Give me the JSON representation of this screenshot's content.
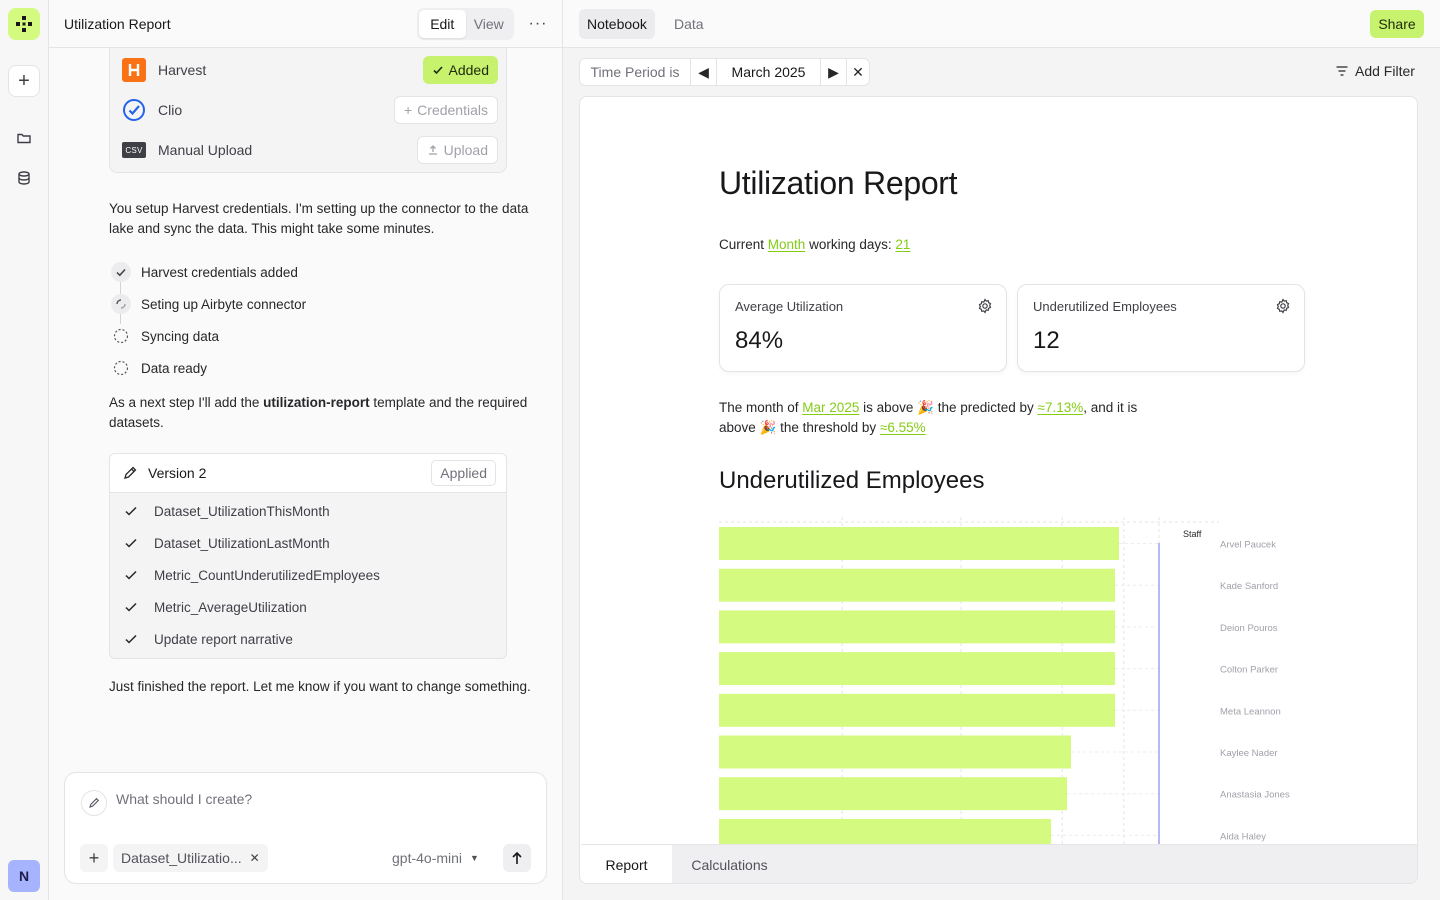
{
  "app": {
    "avatar_initial": "N",
    "brand_color": "#d4fa7f"
  },
  "chat": {
    "title": "Utilization Report",
    "mode_tabs": [
      "Edit",
      "View"
    ],
    "active_mode": "Edit",
    "connectors": [
      {
        "name": "Harvest",
        "icon": "harvest-icon",
        "action": "Added",
        "state": "added"
      },
      {
        "name": "Clio",
        "icon": "clio-icon",
        "action": "Credentials",
        "state": "available"
      },
      {
        "name": "Manual Upload",
        "icon": "csv-icon",
        "icon_text": "CSV",
        "action": "Upload",
        "state": "available"
      }
    ],
    "message_1": "You setup Harvest credentials. I'm setting up the connector to the data lake and sync the data. This might take some minutes.",
    "steps": [
      {
        "label": "Harvest credentials added",
        "status": "done"
      },
      {
        "label": "Seting up Airbyte connector",
        "status": "in-progress"
      },
      {
        "label": "Syncing data",
        "status": "pending"
      },
      {
        "label": "Data ready",
        "status": "pending"
      }
    ],
    "message_2_prefix": "As a next step I'll add the ",
    "message_2_bold": "utilization-report",
    "message_2_suffix": " template and the required datasets.",
    "version": {
      "title": "Version 2",
      "badge": "Applied",
      "items": [
        "Dataset_UtilizationThisMonth",
        "Dataset_UtilizationLastMonth",
        "Metric_CountUnderutilizedEmployees",
        "Metric_AverageUtilization",
        "Update report narrative"
      ]
    },
    "message_3": "Just finished the report. Let me know if you want to change something.",
    "composer": {
      "placeholder": "What should I create?",
      "attachment": "Dataset_Utilizatio...",
      "model": "gpt-4o-mini"
    }
  },
  "notebook": {
    "tabs": [
      "Notebook",
      "Data"
    ],
    "active_tab": "Notebook",
    "share_label": "Share",
    "filter": {
      "label": "Time Period is",
      "value": "March 2025"
    },
    "add_filter_label": "Add Filter",
    "bottom_tabs": [
      "Report",
      "Calculations"
    ],
    "active_bottom_tab": "Report"
  },
  "report": {
    "title": "Utilization Report",
    "current_line": {
      "prefix": "Current ",
      "period_link": "Month",
      "middle": " working days: ",
      "days": "21"
    },
    "kpis": [
      {
        "label": "Average Utilization",
        "value": "84%"
      },
      {
        "label": "Underutilized Employees",
        "value": "12"
      }
    ],
    "narrative": {
      "t1": "The month of ",
      "month_link": "Mar 2025",
      "t2": " is above ",
      "emoji": "🎉",
      "t3": " the predicted by ",
      "predicted_link": "≈7.13%",
      "t4": ",  and it is above ",
      "t5": " the threshold by ",
      "threshold_link": "≈6.55%"
    },
    "section_title": "Underutilized Employees"
  },
  "chart_data": {
    "type": "bar",
    "orientation": "horizontal",
    "series_legend": "Staff",
    "categories": [
      "Arvel Paucek",
      "Kade Sanford",
      "Deion Pouros",
      "Colton Parker",
      "Meta Leannon",
      "Kaylee Nader",
      "Anastasia Jones",
      "Aida Haley"
    ],
    "values": [
      100,
      99,
      99,
      99,
      99,
      88,
      87,
      83
    ],
    "xlim": [
      0,
      110
    ],
    "reference_line": 110,
    "bar_color": "#d4fa7f",
    "reference_color": "#b8b7f5",
    "grid": true
  }
}
